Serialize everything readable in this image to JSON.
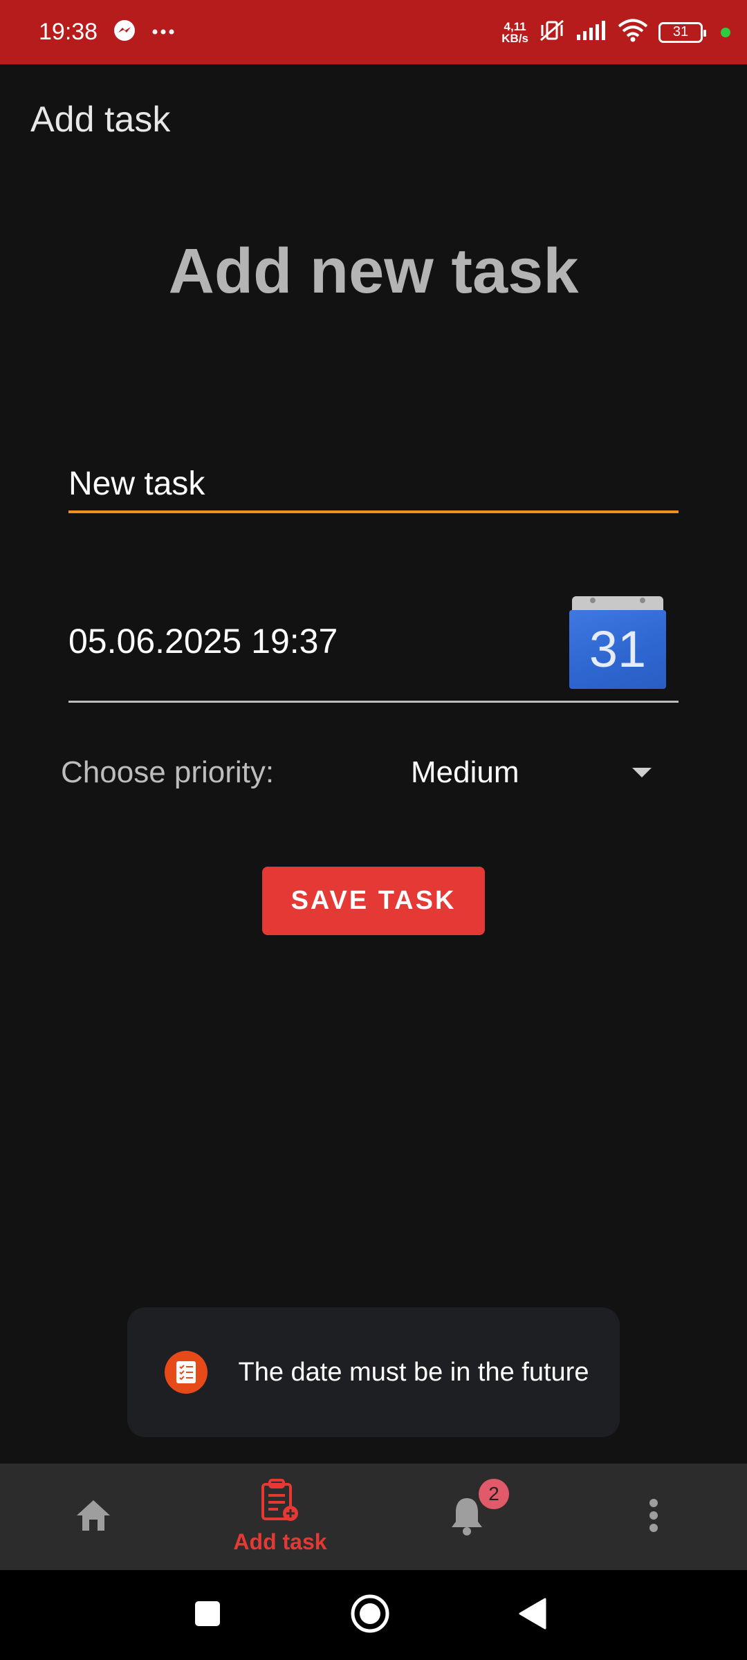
{
  "status_bar": {
    "time": "19:38",
    "net_speed_value": "4,11",
    "net_speed_unit": "KB/s",
    "battery": "31",
    "icons": [
      "messenger-icon",
      "more-dots-icon",
      "mute-vibrate-icon",
      "signal-icon",
      "wifi-icon",
      "battery-icon"
    ],
    "background": "#b71c1c"
  },
  "app_bar": {
    "title": "Add task"
  },
  "page": {
    "heading": "Add new task"
  },
  "form": {
    "task_name_value": "New task",
    "date_value": "05.06.2025 19:37",
    "calendar_day": "31",
    "priority_label": "Choose priority:",
    "priority_value": "Medium",
    "save_label": "SAVE TASK"
  },
  "toast": {
    "message": "The date must be in the future"
  },
  "bottom_nav": {
    "items": [
      {
        "icon": "home-icon",
        "label": "",
        "active": false
      },
      {
        "icon": "add-task-icon",
        "label": "Add task",
        "active": true
      },
      {
        "icon": "notifications-icon",
        "label": "",
        "badge": "2",
        "active": false
      },
      {
        "icon": "more-vertical-icon",
        "label": "",
        "active": false
      }
    ],
    "active_color": "#e53935"
  },
  "system_nav": {
    "icons": [
      "recents-icon",
      "home-circle-icon",
      "back-icon"
    ]
  },
  "colors": {
    "accent": "#e53935",
    "input_underline": "#f0901e",
    "background": "#121212"
  }
}
